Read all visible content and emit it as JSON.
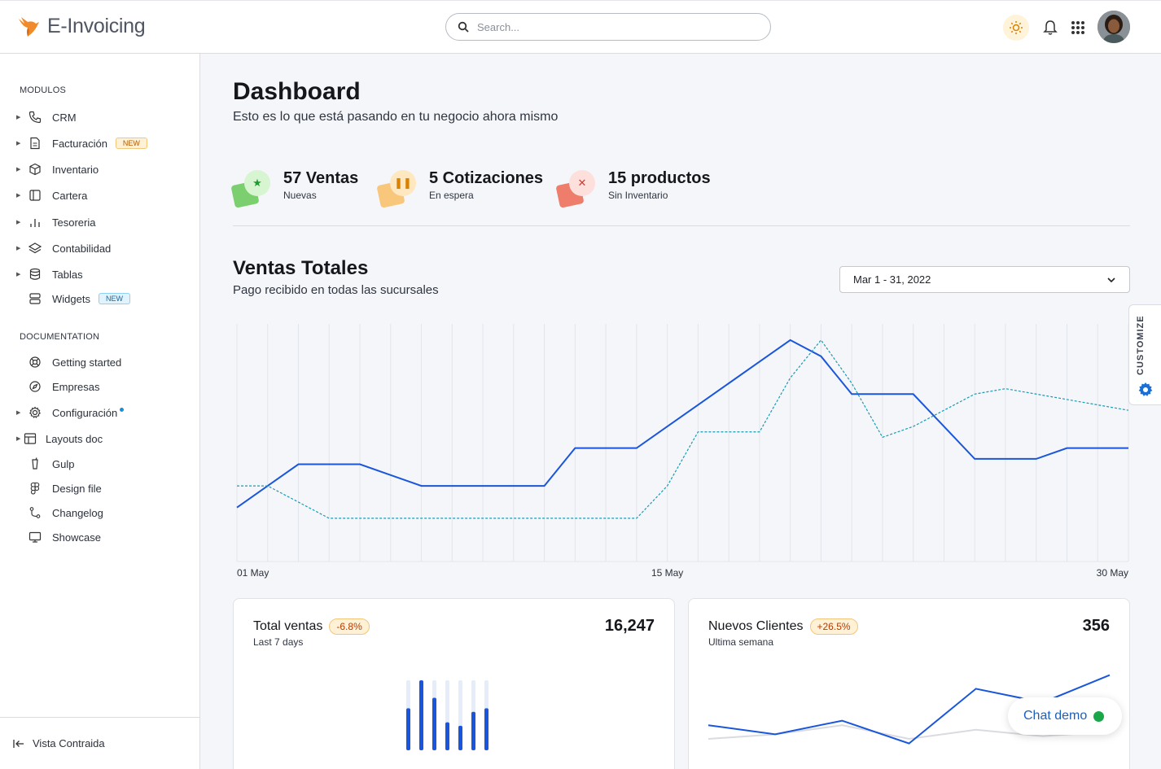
{
  "header": {
    "app_name": "E-Invoicing",
    "search_placeholder": "Search..."
  },
  "sidebar": {
    "modules_title": "MODULOS",
    "modules": [
      {
        "label": "CRM",
        "icon": "phone-icon"
      },
      {
        "label": "Facturación",
        "icon": "document-icon",
        "badge": "NEW"
      },
      {
        "label": "Inventario",
        "icon": "box-icon"
      },
      {
        "label": "Cartera",
        "icon": "columns-icon"
      },
      {
        "label": "Tesoreria",
        "icon": "bar-chart-icon"
      },
      {
        "label": "Contabilidad",
        "icon": "layers-icon"
      },
      {
        "label": "Tablas",
        "icon": "database-icon"
      },
      {
        "label": "Widgets",
        "icon": "widgets-icon",
        "badge": "NEW"
      }
    ],
    "docs_title": "DOCUMENTATION",
    "docs": [
      {
        "label": "Getting started",
        "icon": "lifebuoy-icon"
      },
      {
        "label": "Empresas",
        "icon": "compass-icon"
      },
      {
        "label": "Configuración",
        "icon": "gear-icon"
      },
      {
        "label": "Layouts doc",
        "icon": "layout-icon"
      },
      {
        "label": "Gulp",
        "icon": "gulp-icon"
      },
      {
        "label": "Design file",
        "icon": "figma-icon"
      },
      {
        "label": "Changelog",
        "icon": "git-branch-icon"
      },
      {
        "label": "Showcase",
        "icon": "monitor-icon"
      }
    ],
    "collapse_label": "Vista Contraida"
  },
  "main": {
    "title": "Dashboard",
    "subtitle": "Esto es lo que está pasando en tu negocio ahora mismo",
    "stats": [
      {
        "value": "57 Ventas",
        "label": "Nuevas",
        "color_back": "#7ccf6f",
        "color_front": "#d6f5d0",
        "glyph": "★",
        "glyph_color": "#1f9b2f"
      },
      {
        "value": "5 Cotizaciones",
        "label": "En espera",
        "color_back": "#f9c77c",
        "color_front": "#ffe7bf",
        "glyph": "❚❚",
        "glyph_color": "#d98100"
      },
      {
        "value": "15 productos",
        "label": "Sin Inventario",
        "color_back": "#ee7d6c",
        "color_front": "#fde0dc",
        "glyph": "✕",
        "glyph_color": "#d0392b"
      }
    ],
    "sales_title": "Ventas Totales",
    "sales_subtitle": "Pago recibido en todas las sucursales",
    "date_range": "Mar 1 - 31, 2022",
    "customize_label": "CUSTOMIZE",
    "cards": [
      {
        "title": "Total ventas",
        "pct": "-6.8%",
        "sub": "Last 7 days",
        "value": "16,247"
      },
      {
        "title": "Nuevos Clientes",
        "pct": "+26.5%",
        "sub": "Ultima semana",
        "value": "356"
      }
    ],
    "chat_label": "Chat demo"
  },
  "colors": {
    "accent": "#1a56db",
    "teal": "#1a9bb3",
    "brand_orange": "#f08a2a"
  },
  "chart_data": [
    {
      "type": "line",
      "title": "Ventas Totales",
      "x_tick_labels": [
        "01 May",
        "15 May",
        "30 May"
      ],
      "x": [
        1,
        2,
        3,
        4,
        5,
        6,
        7,
        8,
        9,
        10,
        11,
        12,
        13,
        14,
        15,
        16,
        17,
        18,
        19,
        20,
        21,
        22,
        23,
        24,
        25,
        26,
        27,
        28,
        29,
        30
      ],
      "series": [
        {
          "values": [
            30,
            34,
            38,
            38,
            38,
            36,
            34,
            34,
            34,
            34,
            34,
            41,
            41,
            41,
            45,
            49,
            53,
            57,
            61,
            58,
            51,
            51,
            51,
            45,
            39,
            39,
            39,
            41,
            41,
            41
          ]
        },
        {
          "values": [
            34,
            34,
            31,
            28,
            28,
            28,
            28,
            28,
            28,
            28,
            28,
            28,
            28,
            28,
            34,
            44,
            44,
            44,
            54,
            61,
            53,
            43,
            45,
            48,
            51,
            52,
            51,
            50,
            49,
            48
          ]
        }
      ]
    },
    {
      "type": "bar",
      "title": "Total ventas",
      "values": [
        60,
        100,
        75,
        40,
        35,
        55,
        60
      ]
    },
    {
      "type": "line",
      "title": "Nuevos Clientes",
      "series": [
        {
          "values": [
            40,
            30,
            45,
            20,
            80,
            65,
            95
          ]
        },
        {
          "values": [
            25,
            30,
            40,
            25,
            35,
            28,
            33
          ]
        }
      ]
    }
  ]
}
